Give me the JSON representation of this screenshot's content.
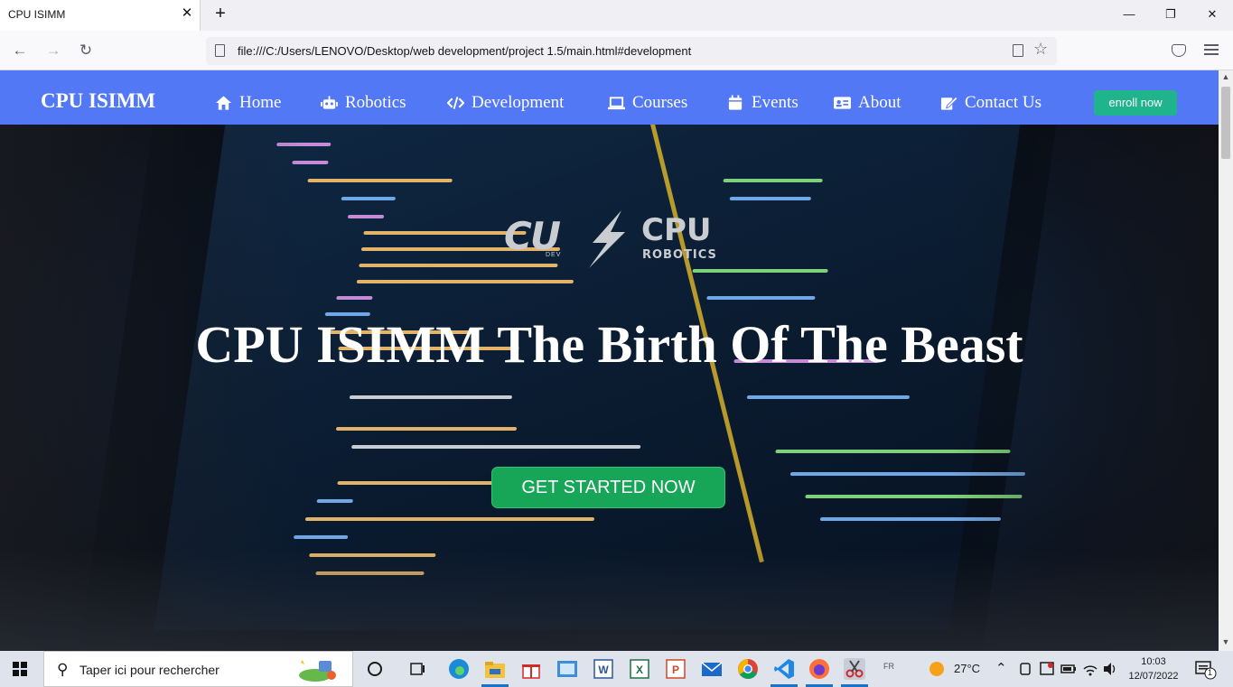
{
  "browser": {
    "tab_title": "CPU ISIMM",
    "tab_close": "✕",
    "new_tab": "+",
    "url": "file:///C:/Users/LENOVO/Desktop/web development/project 1.5/main.html#development",
    "controls": {
      "minimize": "—",
      "restore": "❐",
      "close": "✕"
    },
    "back": "←",
    "forward": "→",
    "reload": "↻",
    "bookmark": "☆"
  },
  "site": {
    "brand": "CPU ISIMM",
    "nav": [
      {
        "label": "Home",
        "icon": "home-icon"
      },
      {
        "label": "Robotics",
        "icon": "robot-icon"
      },
      {
        "label": "Development",
        "icon": "code-icon"
      },
      {
        "label": "Courses",
        "icon": "laptop-icon"
      },
      {
        "label": "Events",
        "icon": "calendar-icon"
      },
      {
        "label": "About",
        "icon": "id-card-icon"
      },
      {
        "label": "Contact Us",
        "icon": "edit-icon"
      }
    ],
    "enroll_label": "enroll now",
    "colors": {
      "nav_bg": "#5378f6",
      "enroll_bg": "#20b48c",
      "cta_bg": "#17a558"
    }
  },
  "hero": {
    "logo": {
      "cu_text": "CU",
      "dev_text": "DEV",
      "cpu_text": "CPU",
      "robotics_text": "ROBOTICS"
    },
    "title": "CPU ISIMM The Birth Of The Beast",
    "cta_label": "GET STARTED NOW"
  },
  "taskbar": {
    "search_placeholder": "Taper ici pour rechercher",
    "apps": [
      "cortana-icon",
      "task-view-icon",
      "edge-icon",
      "file-explorer-icon",
      "gift-icon",
      "photos-icon",
      "word-icon",
      "excel-icon",
      "powerpoint-icon",
      "mail-icon",
      "chrome-icon",
      "vscode-icon",
      "firefox-icon",
      "snipping-tool-icon"
    ],
    "lang": "FR",
    "temperature": "27°C",
    "time": "10:03",
    "date": "12/07/2022",
    "notification_count": "1"
  }
}
